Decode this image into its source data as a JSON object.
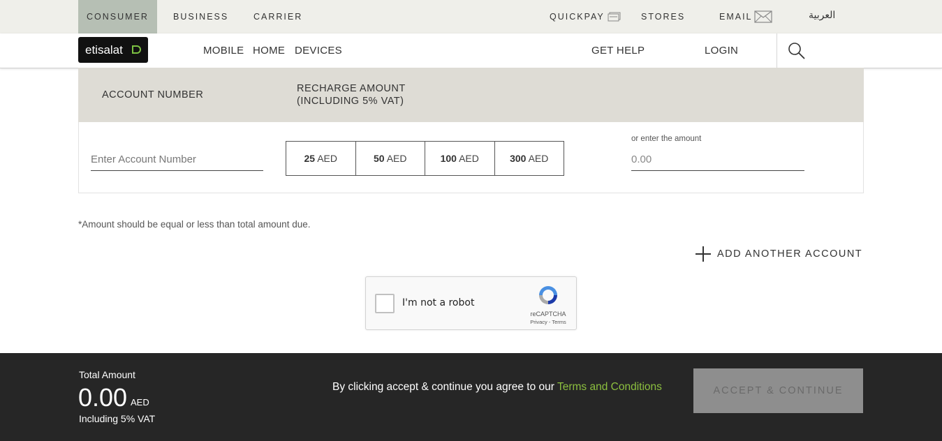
{
  "topbar": {
    "consumer": "CONSUMER",
    "business": "BUSINESS",
    "carrier": "CARRIER",
    "quickpay": "QUICKPAY",
    "stores": "STORES",
    "email": "EMAIL",
    "arabic": "العربية"
  },
  "navbar": {
    "logo": "etisalat",
    "mobile": "MOBILE",
    "home": "HOME",
    "devices": "DEVICES",
    "get_help": "GET HELP",
    "login": "LOGIN"
  },
  "table": {
    "col_account": "ACCOUNT NUMBER",
    "col_recharge_line1": "RECHARGE AMOUNT",
    "col_recharge_line2": "(INCLUDING 5% VAT)",
    "account_placeholder": "Enter Account Number",
    "amounts": [
      {
        "value": "25",
        "unit": "AED"
      },
      {
        "value": "50",
        "unit": "AED"
      },
      {
        "value": "100",
        "unit": "AED"
      },
      {
        "value": "300",
        "unit": "AED"
      }
    ],
    "or_enter_label": "or enter the amount",
    "amount_placeholder": "0.00"
  },
  "note": "*Amount should be equal or less than total amount due.",
  "add_account": "ADD ANOTHER ACCOUNT",
  "captcha": {
    "label": "I'm not a robot",
    "brand": "reCAPTCHA",
    "links": "Privacy - Terms"
  },
  "footer": {
    "total_label": "Total Amount",
    "total_value": "0.00",
    "currency": "AED",
    "vat_label": "Including 5% VAT",
    "agree_text": "By clicking accept & continue you agree to our ",
    "terms_link": "Terms and Conditions",
    "accept_button": "ACCEPT & CONTINUE"
  },
  "colors": {
    "accent_green": "#8cbf3f",
    "footer_bg": "#262626",
    "topbar_bg": "#efefea",
    "active_tab_bg": "#b6bfb4"
  }
}
